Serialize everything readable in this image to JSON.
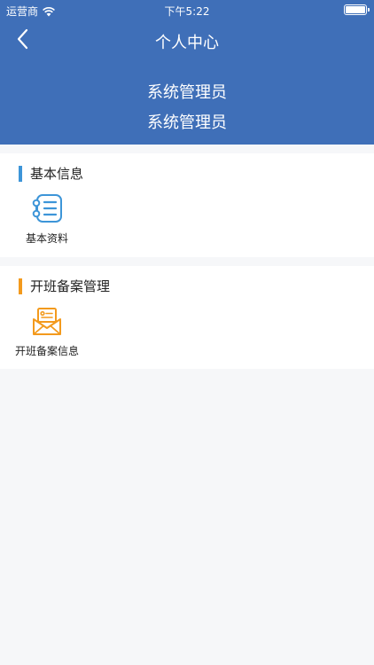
{
  "status_bar": {
    "carrier": "运营商",
    "time": "下午5:22"
  },
  "nav": {
    "title": "个人中心"
  },
  "profile": {
    "name_line1": "系统管理员",
    "name_line2": "系统管理员"
  },
  "sections": [
    {
      "title": "基本信息",
      "accent": "#3d95d8",
      "items": [
        {
          "label": "基本资料",
          "icon": "profile-list-icon"
        }
      ]
    },
    {
      "title": "开班备案管理",
      "accent": "#f39a1d",
      "items": [
        {
          "label": "开班备案信息",
          "icon": "envelope-card-icon"
        }
      ]
    }
  ],
  "colors": {
    "header_bg": "#3f6fb8",
    "page_bg": "#f6f7f9"
  }
}
